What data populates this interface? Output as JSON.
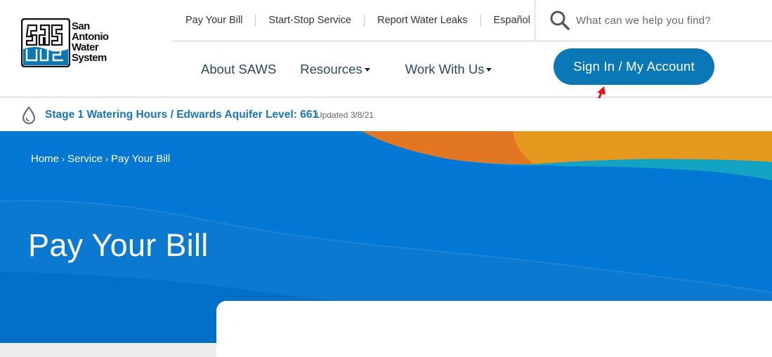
{
  "logo": {
    "line1": "San",
    "line2": "Antonio",
    "line3": "Water",
    "line4": "System"
  },
  "utility_nav": [
    {
      "label": "Pay Your Bill"
    },
    {
      "label": "Start-Stop Service"
    },
    {
      "label": "Report Water Leaks"
    },
    {
      "label": "Español"
    }
  ],
  "search": {
    "placeholder": "What can we help you find?",
    "icon": "search-icon"
  },
  "main_nav": [
    {
      "label": "About SAWS",
      "dropdown": false
    },
    {
      "label": "Resources",
      "dropdown": true
    },
    {
      "label": "Work With Us",
      "dropdown": true
    }
  ],
  "signin_button": {
    "label": "Sign In / My Account"
  },
  "alert": {
    "icon": "water-drop-icon",
    "part1": "Stage 1 Watering Hours",
    "separator": "/",
    "part2": "Edwards Aquifer Level: 661",
    "updated": "Updated 3/8/21"
  },
  "breadcrumb": [
    {
      "label": "Home"
    },
    {
      "label": "Service"
    },
    {
      "label": "Pay Your Bill"
    }
  ],
  "breadcrumb_separator": "›",
  "page_title": "Pay Your Bill",
  "colors": {
    "primary_blue": "#0277d3",
    "button_blue": "#0a78b7",
    "orange": "#e37623",
    "gold": "#e59a1f",
    "teal": "#0fa3c6",
    "arrow_red": "#e8141b"
  }
}
